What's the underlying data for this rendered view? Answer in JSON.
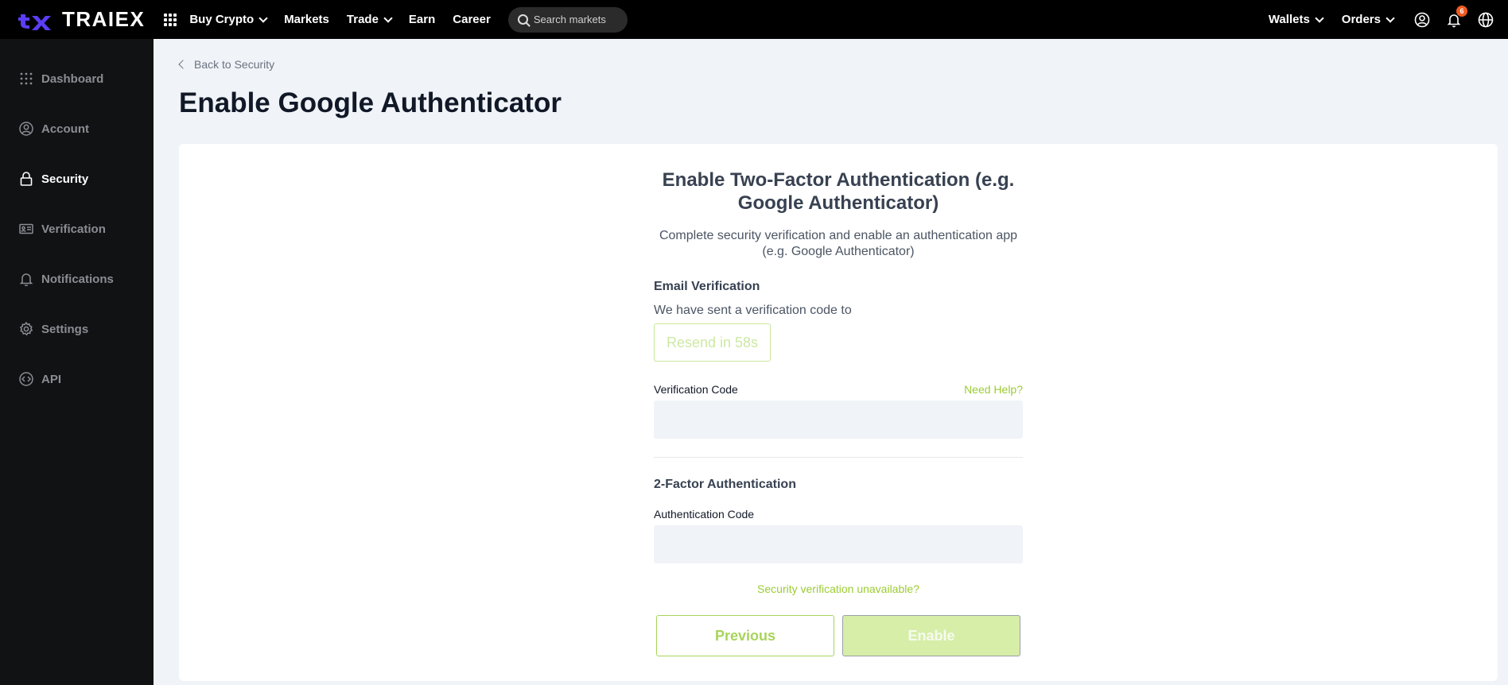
{
  "topbar": {
    "brand": "TRAIEX",
    "nav": [
      "Buy Crypto",
      "Markets",
      "Trade",
      "Earn",
      "Career"
    ],
    "search_placeholder": "Search markets",
    "wallets": "Wallets",
    "orders": "Orders",
    "notification_count": "6",
    "icons": [
      "apps-grid-icon",
      "user-circle-icon",
      "bell-icon",
      "globe-icon"
    ]
  },
  "sidebar": {
    "items": [
      {
        "label": "Dashboard",
        "icon": "dots-grid-icon"
      },
      {
        "label": "Account",
        "icon": "user-icon"
      },
      {
        "label": "Security",
        "icon": "lock-icon",
        "active": true
      },
      {
        "label": "Verification",
        "icon": "id-card-icon"
      },
      {
        "label": "Notifications",
        "icon": "bell-icon"
      },
      {
        "label": "Settings",
        "icon": "gear-icon"
      },
      {
        "label": "API",
        "icon": "code-icon"
      }
    ]
  },
  "main": {
    "back_label": "Back to Security",
    "page_title": "Enable Google Authenticator",
    "form": {
      "title": "Enable Two-Factor Authentication (e.g. Google Authenticator)",
      "subtitle": "Complete security verification and enable an authentication app (e.g. Google Authenticator)",
      "email_heading": "Email Verification",
      "sent_text": "We have sent a verification code to",
      "resend_label": "Resend in 58s",
      "verification_label": "Verification Code",
      "need_help": "Need Help?",
      "verification_value": "",
      "twofa_heading": "2-Factor Authentication",
      "auth_label": "Authentication Code",
      "auth_value": "",
      "unavailable_link": "Security verification unavailable?",
      "previous_label": "Previous",
      "enable_label": "Enable"
    }
  },
  "colors": {
    "brand": "#5b3df5",
    "accent_green": "#9ccc33",
    "sidebar_bg": "#111214",
    "topbar_bg": "#000000",
    "page_bg": "#f0f3f7",
    "badge": "#f05a22"
  }
}
